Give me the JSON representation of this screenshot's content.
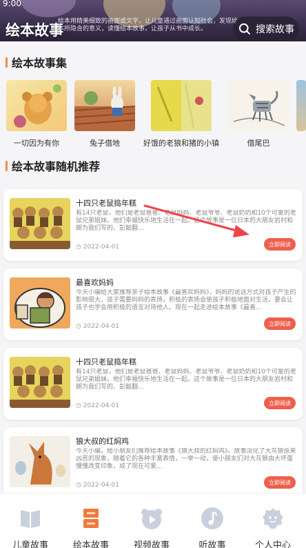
{
  "status": {
    "time": "9:00"
  },
  "header": {
    "title": "绘本故事",
    "description": "绘本用精美细致的画面或文字，让儿童通过画面认知社会，发现绘本所隐含的意义，读懂绘本故事，让孩子从书中成长。",
    "search_label": "搜索故事"
  },
  "collections_section": {
    "title": "绘本故事集",
    "items": [
      {
        "label": "一切因为有你"
      },
      {
        "label": "兔子借地"
      },
      {
        "label": "好饿的老狼和猪的小镇"
      },
      {
        "label": "借尾巴"
      }
    ]
  },
  "recommend_section": {
    "title": "绘本故事随机推荐",
    "cards": [
      {
        "title": "十四只老鼠捣年糕",
        "desc": "有14只老鼠，他们是老鼠爸爸、老鼠妈妈、老鼠爷爷、老鼠奶奶和10个可爱的老鼠兄弟姐妹。他们幸福快乐地生活在一起。这个故事是一位日本的大朋友岩村和朗为我们写的、彭懿翻...",
        "date": "2022-04-01",
        "button": "立即阅读"
      },
      {
        "title": "最喜欢妈妈",
        "desc": "今天小编给大家推荐亲子绘本故事《最喜欢妈妈》，妈妈的说话方式对孩子产生的影响很大，孩子需要妈妈的表扬，积极的表扬会使孩子积极地面对生活，要会让孩子也学会用积极的语言对待他人。现在一起走进绘本故事《最喜...",
        "date": "2022-04-01",
        "button": "立即阅读"
      },
      {
        "title": "十四只老鼠捣年糕",
        "desc": "有14只老鼠，他们是老鼠爸爸、老鼠妈妈、老鼠爷爷、老鼠奶奶和10个可爱的老鼠兄弟姐妹。他们幸福快乐地生活在一起。这个故事是一位日本的大朋友岩村和朗为我们写的、彭懿翻...",
        "date": "2022-04-01",
        "button": "立即阅读"
      },
      {
        "title": "狼大叔的红焖鸡",
        "desc": "今天小编，给小朋友们推荐绘本故事《狼大叔的红焖鸡》。故事淡化了大灰狼原来凶恶的现象，随着它的各种丰富表情，一举一动，使小朋友们对大灰狼由大坏蛋慢慢改变印象，成了现在可爱...",
        "date": "2022-04-01",
        "button": "立即阅读"
      }
    ]
  },
  "tabbar": {
    "items": [
      {
        "label": "儿童故事",
        "icon": "book-icon"
      },
      {
        "label": "绘本故事",
        "icon": "picture-book-icon"
      },
      {
        "label": "视频故事",
        "icon": "video-bear-icon"
      },
      {
        "label": "听故事",
        "icon": "music-note-icon"
      },
      {
        "label": "个人中心",
        "icon": "profile-gear-icon"
      }
    ],
    "active_color": "#f07a3a",
    "inactive_color": "#c9d0dd"
  },
  "colors": {
    "accent": "#f0903a",
    "button": "#ee5f4c",
    "annotation_arrow": "#f0424a"
  }
}
